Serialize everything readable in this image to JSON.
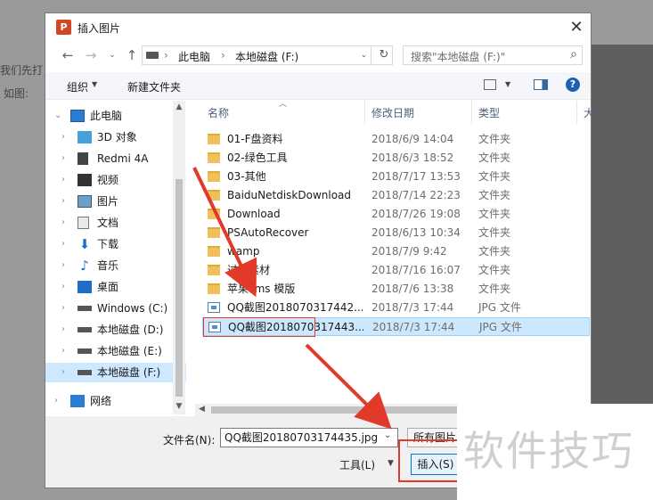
{
  "background": {
    "left_text_1": "我们先打",
    "left_text_2": "如图:"
  },
  "dialog": {
    "title": "插入图片",
    "app_icon_letter": "P",
    "close_glyph": "✕"
  },
  "address": {
    "crumbs": [
      "此电脑",
      "本地磁盘 (F:)"
    ],
    "separator": "›",
    "search_placeholder": "搜索\"本地磁盘 (F:)\""
  },
  "toolbar": {
    "organize_label": "组织",
    "new_folder_label": "新建文件夹"
  },
  "sidebar": {
    "items": [
      {
        "label": "此电脑",
        "icon": "computer-icon"
      },
      {
        "label": "3D 对象",
        "icon": "cube-icon"
      },
      {
        "label": "Redmi 4A",
        "icon": "phone-icon"
      },
      {
        "label": "视频",
        "icon": "video-icon"
      },
      {
        "label": "图片",
        "icon": "picture-icon"
      },
      {
        "label": "文档",
        "icon": "document-icon"
      },
      {
        "label": "下载",
        "icon": "download-icon"
      },
      {
        "label": "音乐",
        "icon": "music-icon"
      },
      {
        "label": "桌面",
        "icon": "desktop-icon"
      },
      {
        "label": "Windows (C:)",
        "icon": "drive-icon"
      },
      {
        "label": "本地磁盘 (D:)",
        "icon": "drive-icon"
      },
      {
        "label": "本地磁盘 (E:)",
        "icon": "drive-icon"
      },
      {
        "label": "本地磁盘 (F:)",
        "icon": "drive-icon"
      },
      {
        "label": "网络",
        "icon": "network-icon"
      }
    ]
  },
  "files": {
    "columns": [
      "名称",
      "修改日期",
      "类型",
      "大"
    ],
    "rows": [
      {
        "name": "01-F盘资料",
        "date": "2018/6/9 14:04",
        "type": "文件夹",
        "kind": "folder"
      },
      {
        "name": "02-绿色工具",
        "date": "2018/6/3 18:52",
        "type": "文件夹",
        "kind": "folder"
      },
      {
        "name": "03-其他",
        "date": "2018/7/17 13:53",
        "type": "文件夹",
        "kind": "folder"
      },
      {
        "name": "BaiduNetdiskDownload",
        "date": "2018/7/14 22:23",
        "type": "文件夹",
        "kind": "folder"
      },
      {
        "name": "Download",
        "date": "2018/7/26 19:08",
        "type": "文件夹",
        "kind": "folder"
      },
      {
        "name": "PSAutoRecover",
        "date": "2018/6/13 10:34",
        "type": "文件夹",
        "kind": "folder"
      },
      {
        "name": "wamp",
        "date": "2018/7/9 9:42",
        "type": "文件夹",
        "kind": "folder"
      },
      {
        "name": "过度素材",
        "date": "2018/7/16 16:07",
        "type": "文件夹",
        "kind": "folder"
      },
      {
        "name": "苹果cms 模版",
        "date": "2018/7/6 13:38",
        "type": "文件夹",
        "kind": "folder"
      },
      {
        "name": "QQ截图2018070317442...",
        "date": "2018/7/3 17:44",
        "type": "JPG 文件",
        "kind": "jpg"
      },
      {
        "name": "QQ截图2018070317443...",
        "date": "2018/7/3 17:44",
        "type": "JPG 文件",
        "kind": "jpg"
      }
    ]
  },
  "bottom": {
    "filename_label": "文件名(N):",
    "filename_value": "QQ截图20180703174435.jpg",
    "filetype_value": "所有图片",
    "tools_label": "工具(L)",
    "insert_label": "插入(S)"
  },
  "watermark": {
    "text": "软件技巧"
  },
  "colors": {
    "annotation_red": "#e23a2a",
    "selection_blue": "#cce8ff",
    "accent_blue": "#0078d7"
  }
}
